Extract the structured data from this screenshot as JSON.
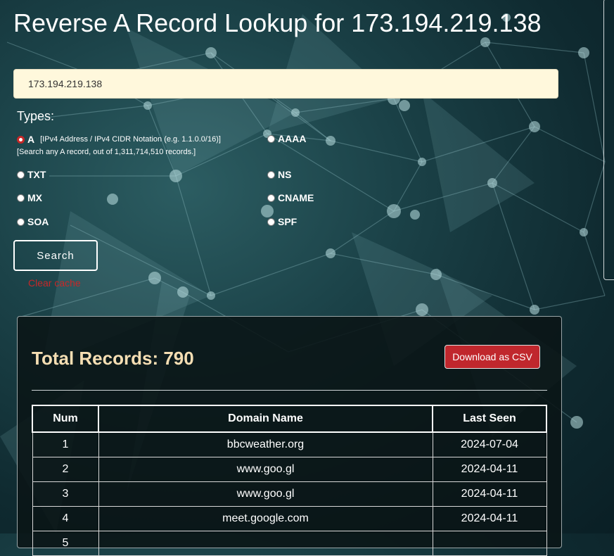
{
  "page": {
    "title": "Reverse A Record Lookup for 173.194.219.138"
  },
  "search": {
    "value": "173.194.219.138",
    "button_label": "Search",
    "clear_cache_label": "Clear cache"
  },
  "types": {
    "label": "Types:",
    "a_label": "A",
    "a_description": "[IPv4 Address / IPv4 CIDR Notation (e.g. 1.1.0.0/16)]",
    "a_subtext": "[Search any A record, out of 1,311,714,510 records.]",
    "aaaa_label": "AAAA",
    "txt_label": "TXT",
    "ns_label": "NS",
    "mx_label": "MX",
    "cname_label": "CNAME",
    "soa_label": "SOA",
    "spf_label": "SPF",
    "selected": "A"
  },
  "results": {
    "total_label": "Total Records: 790",
    "download_label": "Download as CSV",
    "columns": [
      "Num",
      "Domain Name",
      "Last Seen"
    ],
    "rows": [
      {
        "num": "1",
        "domain": "bbcweather.org",
        "last_seen": "2024-07-04"
      },
      {
        "num": "2",
        "domain": "www.goo.gl",
        "last_seen": "2024-04-11"
      },
      {
        "num": "3",
        "domain": "www.goo.gl",
        "last_seen": "2024-04-11"
      },
      {
        "num": "4",
        "domain": "meet.google.com",
        "last_seen": "2024-04-11"
      },
      {
        "num": "5",
        "domain": "",
        "last_seen": ""
      }
    ]
  },
  "colors": {
    "heading_accent": "#f5deb3",
    "danger": "#c0272d",
    "input_bg": "#fff8dc"
  }
}
